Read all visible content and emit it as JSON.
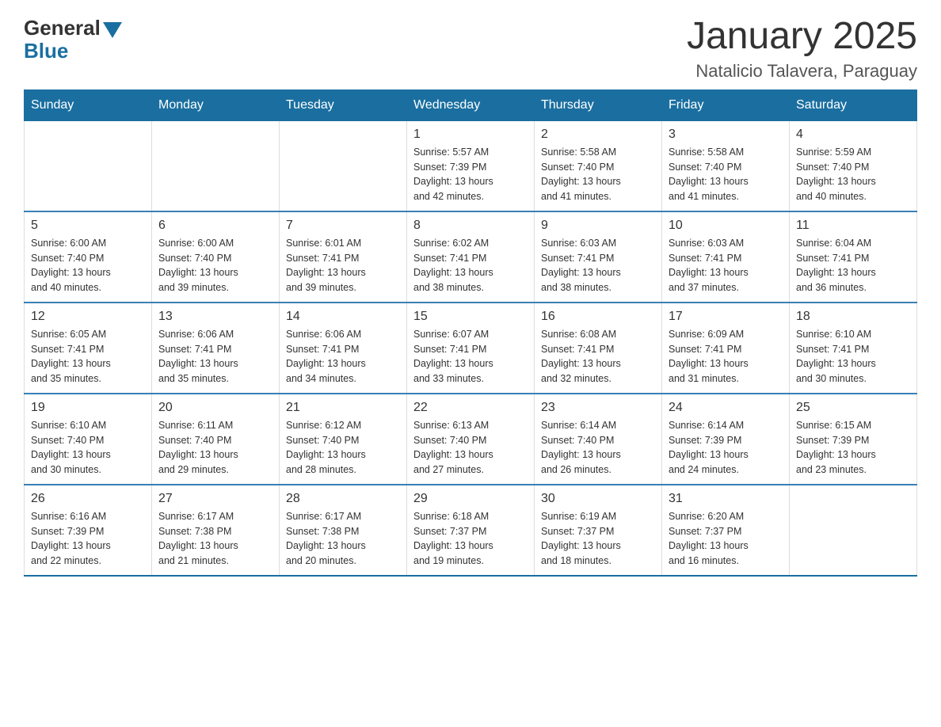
{
  "header": {
    "logo_general": "General",
    "logo_blue": "Blue",
    "title": "January 2025",
    "subtitle": "Natalicio Talavera, Paraguay"
  },
  "days_of_week": [
    "Sunday",
    "Monday",
    "Tuesday",
    "Wednesday",
    "Thursday",
    "Friday",
    "Saturday"
  ],
  "weeks": [
    [
      {
        "day": "",
        "info": ""
      },
      {
        "day": "",
        "info": ""
      },
      {
        "day": "",
        "info": ""
      },
      {
        "day": "1",
        "info": "Sunrise: 5:57 AM\nSunset: 7:39 PM\nDaylight: 13 hours\nand 42 minutes."
      },
      {
        "day": "2",
        "info": "Sunrise: 5:58 AM\nSunset: 7:40 PM\nDaylight: 13 hours\nand 41 minutes."
      },
      {
        "day": "3",
        "info": "Sunrise: 5:58 AM\nSunset: 7:40 PM\nDaylight: 13 hours\nand 41 minutes."
      },
      {
        "day": "4",
        "info": "Sunrise: 5:59 AM\nSunset: 7:40 PM\nDaylight: 13 hours\nand 40 minutes."
      }
    ],
    [
      {
        "day": "5",
        "info": "Sunrise: 6:00 AM\nSunset: 7:40 PM\nDaylight: 13 hours\nand 40 minutes."
      },
      {
        "day": "6",
        "info": "Sunrise: 6:00 AM\nSunset: 7:40 PM\nDaylight: 13 hours\nand 39 minutes."
      },
      {
        "day": "7",
        "info": "Sunrise: 6:01 AM\nSunset: 7:41 PM\nDaylight: 13 hours\nand 39 minutes."
      },
      {
        "day": "8",
        "info": "Sunrise: 6:02 AM\nSunset: 7:41 PM\nDaylight: 13 hours\nand 38 minutes."
      },
      {
        "day": "9",
        "info": "Sunrise: 6:03 AM\nSunset: 7:41 PM\nDaylight: 13 hours\nand 38 minutes."
      },
      {
        "day": "10",
        "info": "Sunrise: 6:03 AM\nSunset: 7:41 PM\nDaylight: 13 hours\nand 37 minutes."
      },
      {
        "day": "11",
        "info": "Sunrise: 6:04 AM\nSunset: 7:41 PM\nDaylight: 13 hours\nand 36 minutes."
      }
    ],
    [
      {
        "day": "12",
        "info": "Sunrise: 6:05 AM\nSunset: 7:41 PM\nDaylight: 13 hours\nand 35 minutes."
      },
      {
        "day": "13",
        "info": "Sunrise: 6:06 AM\nSunset: 7:41 PM\nDaylight: 13 hours\nand 35 minutes."
      },
      {
        "day": "14",
        "info": "Sunrise: 6:06 AM\nSunset: 7:41 PM\nDaylight: 13 hours\nand 34 minutes."
      },
      {
        "day": "15",
        "info": "Sunrise: 6:07 AM\nSunset: 7:41 PM\nDaylight: 13 hours\nand 33 minutes."
      },
      {
        "day": "16",
        "info": "Sunrise: 6:08 AM\nSunset: 7:41 PM\nDaylight: 13 hours\nand 32 minutes."
      },
      {
        "day": "17",
        "info": "Sunrise: 6:09 AM\nSunset: 7:41 PM\nDaylight: 13 hours\nand 31 minutes."
      },
      {
        "day": "18",
        "info": "Sunrise: 6:10 AM\nSunset: 7:41 PM\nDaylight: 13 hours\nand 30 minutes."
      }
    ],
    [
      {
        "day": "19",
        "info": "Sunrise: 6:10 AM\nSunset: 7:40 PM\nDaylight: 13 hours\nand 30 minutes."
      },
      {
        "day": "20",
        "info": "Sunrise: 6:11 AM\nSunset: 7:40 PM\nDaylight: 13 hours\nand 29 minutes."
      },
      {
        "day": "21",
        "info": "Sunrise: 6:12 AM\nSunset: 7:40 PM\nDaylight: 13 hours\nand 28 minutes."
      },
      {
        "day": "22",
        "info": "Sunrise: 6:13 AM\nSunset: 7:40 PM\nDaylight: 13 hours\nand 27 minutes."
      },
      {
        "day": "23",
        "info": "Sunrise: 6:14 AM\nSunset: 7:40 PM\nDaylight: 13 hours\nand 26 minutes."
      },
      {
        "day": "24",
        "info": "Sunrise: 6:14 AM\nSunset: 7:39 PM\nDaylight: 13 hours\nand 24 minutes."
      },
      {
        "day": "25",
        "info": "Sunrise: 6:15 AM\nSunset: 7:39 PM\nDaylight: 13 hours\nand 23 minutes."
      }
    ],
    [
      {
        "day": "26",
        "info": "Sunrise: 6:16 AM\nSunset: 7:39 PM\nDaylight: 13 hours\nand 22 minutes."
      },
      {
        "day": "27",
        "info": "Sunrise: 6:17 AM\nSunset: 7:38 PM\nDaylight: 13 hours\nand 21 minutes."
      },
      {
        "day": "28",
        "info": "Sunrise: 6:17 AM\nSunset: 7:38 PM\nDaylight: 13 hours\nand 20 minutes."
      },
      {
        "day": "29",
        "info": "Sunrise: 6:18 AM\nSunset: 7:37 PM\nDaylight: 13 hours\nand 19 minutes."
      },
      {
        "day": "30",
        "info": "Sunrise: 6:19 AM\nSunset: 7:37 PM\nDaylight: 13 hours\nand 18 minutes."
      },
      {
        "day": "31",
        "info": "Sunrise: 6:20 AM\nSunset: 7:37 PM\nDaylight: 13 hours\nand 16 minutes."
      },
      {
        "day": "",
        "info": ""
      }
    ]
  ]
}
